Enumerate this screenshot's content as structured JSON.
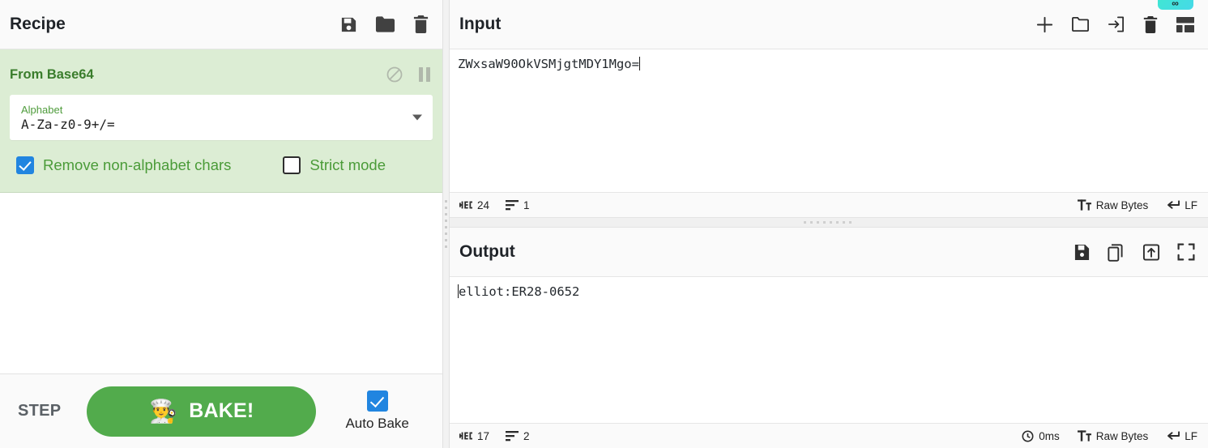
{
  "recipe": {
    "title": "Recipe",
    "header_icons": [
      {
        "name": "save-recipe-icon",
        "glyph": "floppy"
      },
      {
        "name": "load-recipe-icon",
        "glyph": "folder"
      },
      {
        "name": "clear-recipe-icon",
        "glyph": "trash"
      }
    ],
    "operations": [
      {
        "name": "From Base64",
        "icons": [
          {
            "name": "disable-operation-icon",
            "glyph": "ban"
          },
          {
            "name": "breakpoint-operation-icon",
            "glyph": "pause"
          }
        ],
        "arg_label": "Alphabet",
        "arg_value": "A-Za-z0-9+/=",
        "checkboxes": [
          {
            "label": "Remove non-alphabet chars",
            "checked": true
          },
          {
            "label": "Strict mode",
            "checked": false
          }
        ]
      }
    ]
  },
  "controls": {
    "step_label": "STEP",
    "bake_label": "BAKE!",
    "bake_emoji": "👨‍🍳",
    "auto_bake_label": "Auto Bake",
    "auto_bake_checked": true
  },
  "input": {
    "title": "Input",
    "value": "ZWxsaW90OkVSMjgtMDY1Mgo=",
    "header_icons": [
      {
        "name": "add-input-tab-icon",
        "glyph": "plus"
      },
      {
        "name": "open-folder-as-input-icon",
        "glyph": "folder-outline"
      },
      {
        "name": "open-file-as-input-icon",
        "glyph": "arrow-into-box"
      },
      {
        "name": "clear-io-icon",
        "glyph": "trash"
      },
      {
        "name": "reset-pane-layout-icon",
        "glyph": "layout"
      }
    ],
    "status": {
      "length_label": "24",
      "lines_label": "1",
      "encoding_label": "Raw Bytes",
      "line_ending_label": "LF"
    }
  },
  "output": {
    "title": "Output",
    "value": "elliot:ER28-0652",
    "header_icons": [
      {
        "name": "save-output-icon",
        "glyph": "floppy"
      },
      {
        "name": "copy-output-icon",
        "glyph": "copy"
      },
      {
        "name": "replace-input-with-output-icon",
        "glyph": "box-up-arrow"
      },
      {
        "name": "maximise-output-icon",
        "glyph": "expand"
      }
    ],
    "status": {
      "length_label": "17",
      "lines_label": "2",
      "duration_label": "0ms",
      "encoding_label": "Raw Bytes",
      "line_ending_label": "LF"
    }
  },
  "magic_badge": {
    "label": "∞"
  },
  "colors": {
    "operation_bg": "#dcedd4",
    "operation_title": "#3a7d2c",
    "bake_green": "#52ab4c",
    "checkbox_blue": "#2185e0",
    "badge_cyan": "#3fe8d0"
  }
}
